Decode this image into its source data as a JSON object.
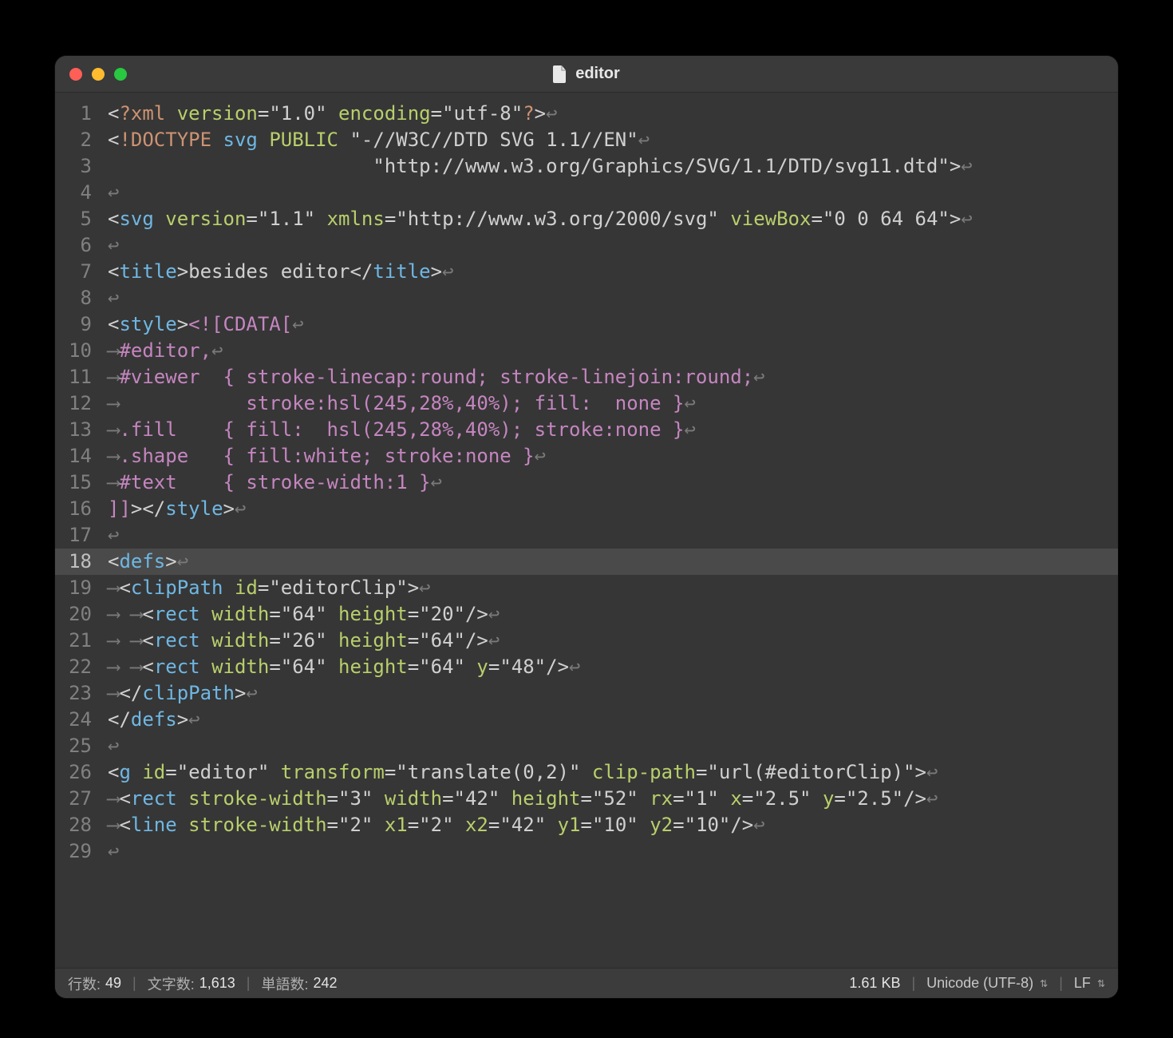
{
  "window": {
    "title": "editor"
  },
  "gutter": {
    "count": 29,
    "current": 18
  },
  "code": {
    "lines": [
      [
        [
          "ang",
          "<"
        ],
        [
          "pi",
          "?xml"
        ],
        [
          "pun",
          " "
        ],
        [
          "attr",
          "version"
        ],
        [
          "pun",
          "="
        ],
        [
          "str",
          "\"1.0\""
        ],
        [
          "pun",
          " "
        ],
        [
          "attr",
          "encoding"
        ],
        [
          "pun",
          "="
        ],
        [
          "str",
          "\"utf-8\""
        ],
        [
          "pi",
          "?"
        ],
        [
          "ang",
          ">"
        ],
        [
          "eol",
          "↩"
        ]
      ],
      [
        [
          "ang",
          "<"
        ],
        [
          "dt",
          "!DOCTYPE"
        ],
        [
          "pun",
          " "
        ],
        [
          "tag",
          "svg"
        ],
        [
          "pun",
          " "
        ],
        [
          "attr",
          "PUBLIC"
        ],
        [
          "pun",
          " "
        ],
        [
          "str",
          "\"-//W3C//DTD SVG 1.1//EN\""
        ],
        [
          "eol",
          "↩"
        ]
      ],
      [
        [
          "pun",
          "                       "
        ],
        [
          "str",
          "\"http://www.w3.org/Graphics/SVG/1.1/DTD/svg11.dtd\""
        ],
        [
          "ang",
          ">"
        ],
        [
          "eol",
          "↩"
        ]
      ],
      [
        [
          "eol",
          "↩"
        ]
      ],
      [
        [
          "ang",
          "<"
        ],
        [
          "tag",
          "svg"
        ],
        [
          "pun",
          " "
        ],
        [
          "attr",
          "version"
        ],
        [
          "pun",
          "="
        ],
        [
          "str",
          "\"1.1\""
        ],
        [
          "pun",
          " "
        ],
        [
          "attr",
          "xmlns"
        ],
        [
          "pun",
          "="
        ],
        [
          "str",
          "\"http://www.w3.org/2000/svg\""
        ],
        [
          "pun",
          " "
        ],
        [
          "attr",
          "viewBox"
        ],
        [
          "pun",
          "="
        ],
        [
          "str",
          "\"0 0 64 64\""
        ],
        [
          "ang",
          ">"
        ],
        [
          "eol",
          "↩"
        ]
      ],
      [
        [
          "eol",
          "↩"
        ]
      ],
      [
        [
          "ang",
          "<"
        ],
        [
          "tag",
          "title"
        ],
        [
          "ang",
          ">"
        ],
        [
          "pun",
          "besides editor"
        ],
        [
          "ang",
          "</"
        ],
        [
          "tag",
          "title"
        ],
        [
          "ang",
          ">"
        ],
        [
          "eol",
          "↩"
        ]
      ],
      [
        [
          "eol",
          "↩"
        ]
      ],
      [
        [
          "ang",
          "<"
        ],
        [
          "tag",
          "style"
        ],
        [
          "ang",
          ">"
        ],
        [
          "cd",
          "<![CDATA["
        ],
        [
          "eol",
          "↩"
        ]
      ],
      [
        [
          "indent",
          "⟶"
        ],
        [
          "sel",
          "#editor"
        ],
        [
          "css",
          ","
        ],
        [
          "eol",
          "↩"
        ]
      ],
      [
        [
          "indent",
          "⟶"
        ],
        [
          "sel",
          "#viewer"
        ],
        [
          "css",
          "  { stroke-linecap:round; stroke-linejoin:round;"
        ],
        [
          "eol",
          "↩"
        ]
      ],
      [
        [
          "indent",
          "⟶"
        ],
        [
          "css",
          "           stroke:hsl(245,28%,40%); fill:  none }"
        ],
        [
          "eol",
          "↩"
        ]
      ],
      [
        [
          "indent",
          "⟶"
        ],
        [
          "sel",
          ".fill"
        ],
        [
          "css",
          "    { fill:  hsl(245,28%,40%); stroke:none }"
        ],
        [
          "eol",
          "↩"
        ]
      ],
      [
        [
          "indent",
          "⟶"
        ],
        [
          "sel",
          ".shape"
        ],
        [
          "css",
          "   { fill:white; stroke:none }"
        ],
        [
          "eol",
          "↩"
        ]
      ],
      [
        [
          "indent",
          "⟶"
        ],
        [
          "sel",
          "#text"
        ],
        [
          "css",
          "    { stroke-width:1 }"
        ],
        [
          "eol",
          "↩"
        ]
      ],
      [
        [
          "cd",
          "]]"
        ],
        [
          "ang",
          ">"
        ],
        [
          "ang",
          "</"
        ],
        [
          "tag",
          "style"
        ],
        [
          "ang",
          ">"
        ],
        [
          "eol",
          "↩"
        ]
      ],
      [
        [
          "eol",
          "↩"
        ]
      ],
      [
        [
          "ang",
          "<"
        ],
        [
          "tag",
          "defs"
        ],
        [
          "ang",
          ">"
        ],
        [
          "eol",
          "↩"
        ]
      ],
      [
        [
          "indent",
          "⟶"
        ],
        [
          "ang",
          "<"
        ],
        [
          "tag",
          "clipPath"
        ],
        [
          "pun",
          " "
        ],
        [
          "attr",
          "id"
        ],
        [
          "pun",
          "="
        ],
        [
          "str",
          "\"editorClip\""
        ],
        [
          "ang",
          ">"
        ],
        [
          "eol",
          "↩"
        ]
      ],
      [
        [
          "indent",
          "⟶ ⟶"
        ],
        [
          "ang",
          "<"
        ],
        [
          "tag",
          "rect"
        ],
        [
          "pun",
          " "
        ],
        [
          "attr",
          "width"
        ],
        [
          "pun",
          "="
        ],
        [
          "str",
          "\"64\""
        ],
        [
          "pun",
          " "
        ],
        [
          "attr",
          "height"
        ],
        [
          "pun",
          "="
        ],
        [
          "str",
          "\"20\""
        ],
        [
          "ang",
          "/>"
        ],
        [
          "eol",
          "↩"
        ]
      ],
      [
        [
          "indent",
          "⟶ ⟶"
        ],
        [
          "ang",
          "<"
        ],
        [
          "tag",
          "rect"
        ],
        [
          "pun",
          " "
        ],
        [
          "attr",
          "width"
        ],
        [
          "pun",
          "="
        ],
        [
          "str",
          "\"26\""
        ],
        [
          "pun",
          " "
        ],
        [
          "attr",
          "height"
        ],
        [
          "pun",
          "="
        ],
        [
          "str",
          "\"64\""
        ],
        [
          "ang",
          "/>"
        ],
        [
          "eol",
          "↩"
        ]
      ],
      [
        [
          "indent",
          "⟶ ⟶"
        ],
        [
          "ang",
          "<"
        ],
        [
          "tag",
          "rect"
        ],
        [
          "pun",
          " "
        ],
        [
          "attr",
          "width"
        ],
        [
          "pun",
          "="
        ],
        [
          "str",
          "\"64\""
        ],
        [
          "pun",
          " "
        ],
        [
          "attr",
          "height"
        ],
        [
          "pun",
          "="
        ],
        [
          "str",
          "\"64\""
        ],
        [
          "pun",
          " "
        ],
        [
          "attr",
          "y"
        ],
        [
          "pun",
          "="
        ],
        [
          "str",
          "\"48\""
        ],
        [
          "ang",
          "/>"
        ],
        [
          "eol",
          "↩"
        ]
      ],
      [
        [
          "indent",
          "⟶"
        ],
        [
          "ang",
          "</"
        ],
        [
          "tag",
          "clipPath"
        ],
        [
          "ang",
          ">"
        ],
        [
          "eol",
          "↩"
        ]
      ],
      [
        [
          "ang",
          "</"
        ],
        [
          "tag",
          "defs"
        ],
        [
          "ang",
          ">"
        ],
        [
          "eol",
          "↩"
        ]
      ],
      [
        [
          "eol",
          "↩"
        ]
      ],
      [
        [
          "ang",
          "<"
        ],
        [
          "tag",
          "g"
        ],
        [
          "pun",
          " "
        ],
        [
          "attr",
          "id"
        ],
        [
          "pun",
          "="
        ],
        [
          "str",
          "\"editor\""
        ],
        [
          "pun",
          " "
        ],
        [
          "attr",
          "transform"
        ],
        [
          "pun",
          "="
        ],
        [
          "str",
          "\"translate(0,2)\""
        ],
        [
          "pun",
          " "
        ],
        [
          "attr",
          "clip-path"
        ],
        [
          "pun",
          "="
        ],
        [
          "str",
          "\"url(#editorClip)\""
        ],
        [
          "ang",
          ">"
        ],
        [
          "eol",
          "↩"
        ]
      ],
      [
        [
          "indent",
          "⟶"
        ],
        [
          "ang",
          "<"
        ],
        [
          "tag",
          "rect"
        ],
        [
          "pun",
          " "
        ],
        [
          "attr",
          "stroke-width"
        ],
        [
          "pun",
          "="
        ],
        [
          "str",
          "\"3\""
        ],
        [
          "pun",
          " "
        ],
        [
          "attr",
          "width"
        ],
        [
          "pun",
          "="
        ],
        [
          "str",
          "\"42\""
        ],
        [
          "pun",
          " "
        ],
        [
          "attr",
          "height"
        ],
        [
          "pun",
          "="
        ],
        [
          "str",
          "\"52\""
        ],
        [
          "pun",
          " "
        ],
        [
          "attr",
          "rx"
        ],
        [
          "pun",
          "="
        ],
        [
          "str",
          "\"1\""
        ],
        [
          "pun",
          " "
        ],
        [
          "attr",
          "x"
        ],
        [
          "pun",
          "="
        ],
        [
          "str",
          "\"2.5\""
        ],
        [
          "pun",
          " "
        ],
        [
          "attr",
          "y"
        ],
        [
          "pun",
          "="
        ],
        [
          "str",
          "\"2.5\""
        ],
        [
          "ang",
          "/>"
        ],
        [
          "eol",
          "↩"
        ]
      ],
      [
        [
          "indent",
          "⟶"
        ],
        [
          "ang",
          "<"
        ],
        [
          "tag",
          "line"
        ],
        [
          "pun",
          " "
        ],
        [
          "attr",
          "stroke-width"
        ],
        [
          "pun",
          "="
        ],
        [
          "str",
          "\"2\""
        ],
        [
          "pun",
          " "
        ],
        [
          "attr",
          "x1"
        ],
        [
          "pun",
          "="
        ],
        [
          "str",
          "\"2\""
        ],
        [
          "pun",
          " "
        ],
        [
          "attr",
          "x2"
        ],
        [
          "pun",
          "="
        ],
        [
          "str",
          "\"42\""
        ],
        [
          "pun",
          " "
        ],
        [
          "attr",
          "y1"
        ],
        [
          "pun",
          "="
        ],
        [
          "str",
          "\"10\""
        ],
        [
          "pun",
          " "
        ],
        [
          "attr",
          "y2"
        ],
        [
          "pun",
          "="
        ],
        [
          "str",
          "\"10\""
        ],
        [
          "ang",
          "/>"
        ],
        [
          "eol",
          "↩"
        ]
      ],
      [
        [
          "eol",
          "↩"
        ]
      ]
    ]
  },
  "status": {
    "lines_label": "行数:",
    "lines_value": "49",
    "chars_label": "文字数:",
    "chars_value": "1,613",
    "words_label": "単語数:",
    "words_value": "242",
    "filesize": "1.61 KB",
    "encoding": "Unicode (UTF-8)",
    "lineend": "LF"
  }
}
